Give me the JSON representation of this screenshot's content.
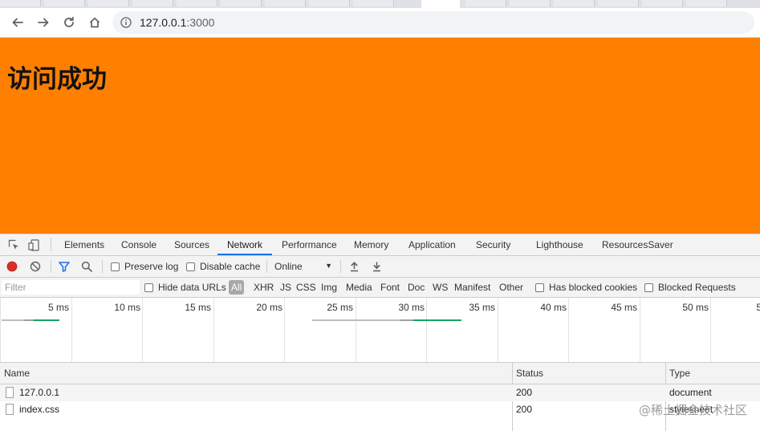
{
  "browser": {
    "url_host": "127.0.0.1",
    "url_port": ":3000"
  },
  "page": {
    "heading": "访问成功",
    "background_color": "#ff7f00"
  },
  "devtools": {
    "tabs": [
      "Elements",
      "Console",
      "Sources",
      "Network",
      "Performance",
      "Memory",
      "Application",
      "Security",
      "Lighthouse",
      "ResourcesSaver"
    ],
    "active_tab": "Network",
    "toolbar": {
      "preserve_log": "Preserve log",
      "disable_cache": "Disable cache",
      "throttle": "Online"
    },
    "filter": {
      "placeholder": "Filter",
      "hide_data_urls": "Hide data URLs",
      "types": [
        "All",
        "XHR",
        "JS",
        "CSS",
        "Img",
        "Media",
        "Font",
        "Doc",
        "WS",
        "Manifest",
        "Other"
      ],
      "has_blocked_cookies": "Has blocked cookies",
      "blocked_requests": "Blocked Requests"
    },
    "overview_ticks": [
      "5 ms",
      "10 ms",
      "15 ms",
      "20 ms",
      "25 ms",
      "30 ms",
      "35 ms",
      "40 ms",
      "45 ms",
      "50 ms",
      "5"
    ],
    "columns": {
      "name": "Name",
      "status": "Status",
      "type": "Type"
    },
    "requests": [
      {
        "name": "127.0.0.1",
        "status": "200",
        "type": "document"
      },
      {
        "name": "index.css",
        "status": "200",
        "type": "stylesheet"
      }
    ]
  },
  "watermark": "@稀土掘金技术社区"
}
